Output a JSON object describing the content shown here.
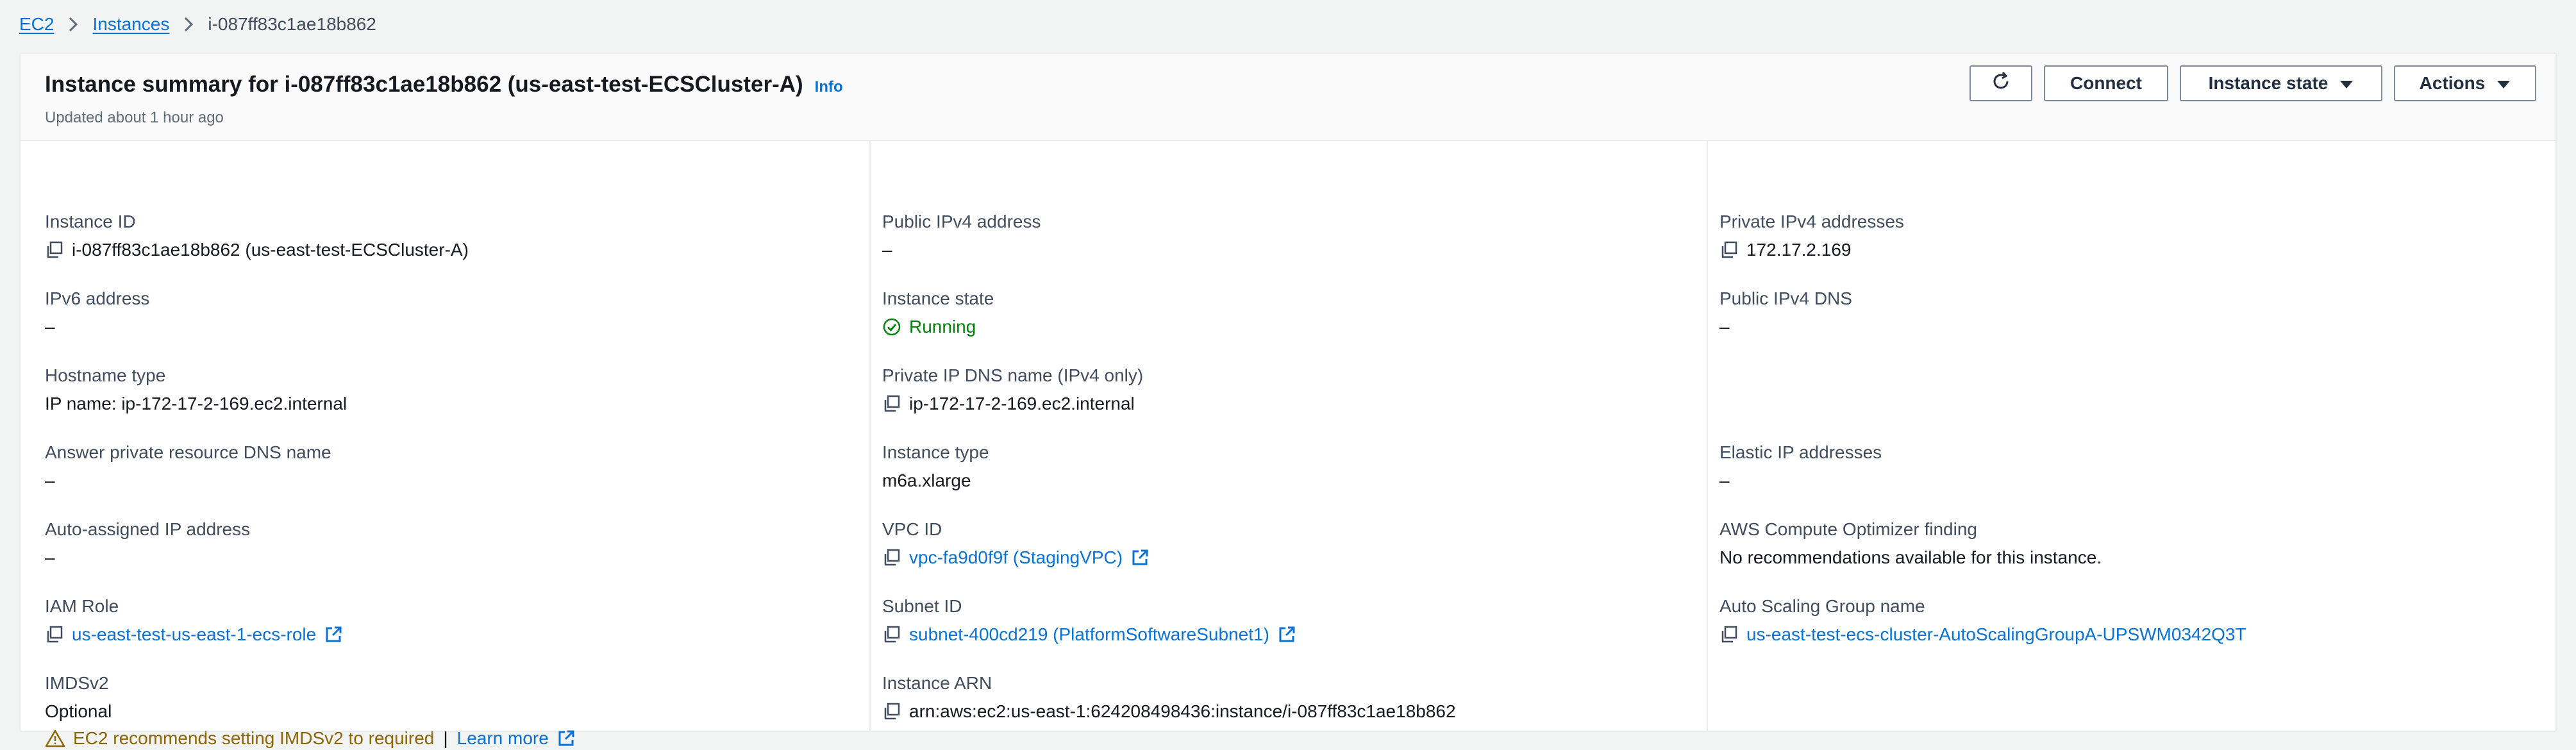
{
  "breadcrumb": {
    "items": [
      "EC2",
      "Instances"
    ],
    "current": "i-087ff83c1ae18b862"
  },
  "header": {
    "title": "Instance summary for i-087ff83c1ae18b862 (us-east-test-ECSCluster-A)",
    "info": "Info",
    "updated": "Updated about 1 hour ago"
  },
  "buttons": {
    "connect": "Connect",
    "instance_state": "Instance state",
    "actions": "Actions"
  },
  "col1": {
    "instance_id": {
      "label": "Instance ID",
      "value": "i-087ff83c1ae18b862 (us-east-test-ECSCluster-A)"
    },
    "ipv6": {
      "label": "IPv6 address",
      "value": "–"
    },
    "hostname_type": {
      "label": "Hostname type",
      "value": "IP name: ip-172-17-2-169.ec2.internal"
    },
    "answer_dns": {
      "label": "Answer private resource DNS name",
      "value": "–"
    },
    "auto_ip": {
      "label": "Auto-assigned IP address",
      "value": "–"
    },
    "iam_role": {
      "label": "IAM Role",
      "value": "us-east-test-us-east-1-ecs-role"
    },
    "imdsv2": {
      "label": "IMDSv2",
      "value": "Optional",
      "warning": "EC2 recommends setting IMDSv2 to required",
      "learn_more": "Learn more"
    }
  },
  "col2": {
    "public_ipv4": {
      "label": "Public IPv4 address",
      "value": "–"
    },
    "instance_state": {
      "label": "Instance state",
      "value": "Running"
    },
    "private_dns": {
      "label": "Private IP DNS name (IPv4 only)",
      "value": "ip-172-17-2-169.ec2.internal"
    },
    "instance_type": {
      "label": "Instance type",
      "value": "m6a.xlarge"
    },
    "vpc_id": {
      "label": "VPC ID",
      "value": "vpc-fa9d0f9f (StagingVPC)"
    },
    "subnet_id": {
      "label": "Subnet ID",
      "value": "subnet-400cd219 (PlatformSoftwareSubnet1)"
    },
    "instance_arn": {
      "label": "Instance ARN",
      "value": "arn:aws:ec2:us-east-1:624208498436:instance/i-087ff83c1ae18b862"
    }
  },
  "col3": {
    "private_ipv4": {
      "label": "Private IPv4 addresses",
      "value": "172.17.2.169"
    },
    "public_dns": {
      "label": "Public IPv4 DNS",
      "value": "–"
    },
    "elastic_ip": {
      "label": "Elastic IP addresses",
      "value": "–"
    },
    "optimizer": {
      "label": "AWS Compute Optimizer finding",
      "value": "No recommendations available for this instance."
    },
    "asg_name": {
      "label": "Auto Scaling Group name",
      "value": "us-east-test-ecs-cluster-AutoScalingGroupA-UPSWM0342Q3T"
    }
  },
  "colors": {
    "link": "#0972d3",
    "running": "#037f0c",
    "warning": "#8d6605",
    "label": "#414d5c"
  },
  "icons": [
    "chevron-right-icon",
    "refresh-icon",
    "caret-down-icon",
    "copy-icon",
    "external-link-icon",
    "check-circle-icon",
    "warning-icon"
  ]
}
